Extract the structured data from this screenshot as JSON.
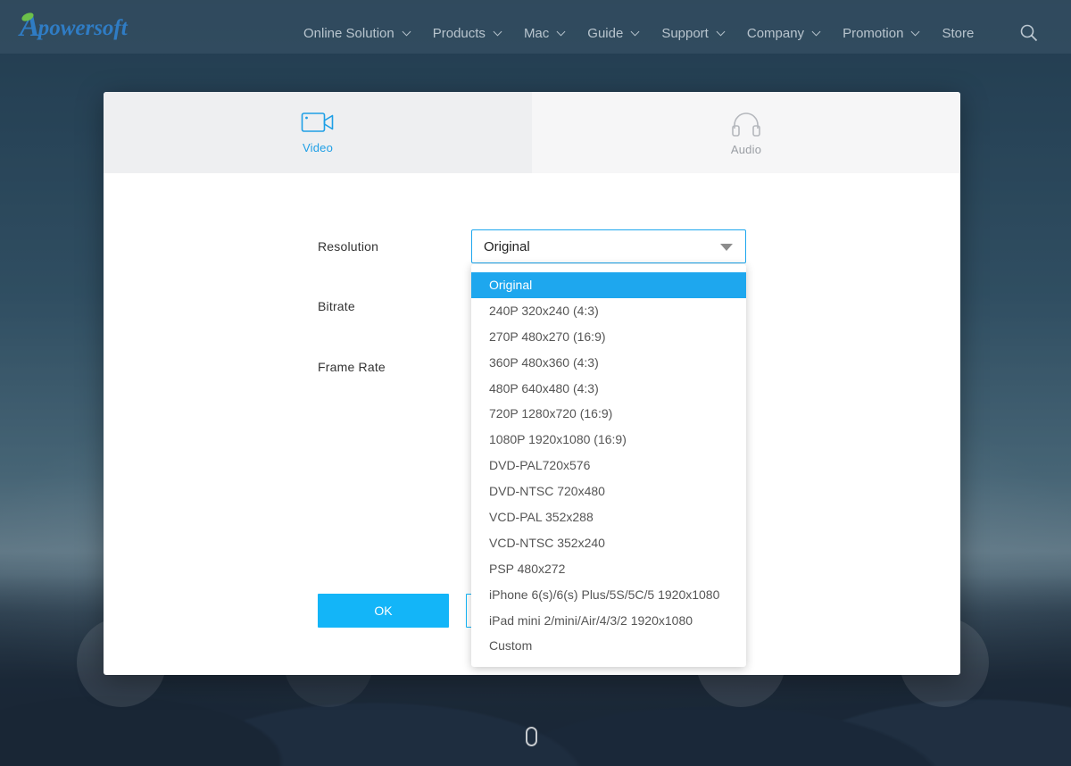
{
  "brand": {
    "logo_letter": "A",
    "logo_text": "powersoft"
  },
  "nav": {
    "items": [
      {
        "label": "Online Solution",
        "has_menu": true
      },
      {
        "label": "Products",
        "has_menu": true
      },
      {
        "label": "Mac",
        "has_menu": true
      },
      {
        "label": "Guide",
        "has_menu": true
      },
      {
        "label": "Support",
        "has_menu": true
      },
      {
        "label": "Company",
        "has_menu": true
      },
      {
        "label": "Promotion",
        "has_menu": true
      },
      {
        "label": "Store",
        "has_menu": false
      }
    ],
    "search_icon": "search-icon"
  },
  "modal": {
    "tabs": [
      {
        "label": "Video",
        "icon": "video-camera-icon",
        "active": true
      },
      {
        "label": "Audio",
        "icon": "headphones-icon",
        "active": false
      }
    ],
    "fields": {
      "resolution_label": "Resolution",
      "bitrate_label": "Bitrate",
      "frame_rate_label": "Frame Rate"
    },
    "resolution_select": {
      "value": "Original",
      "options": [
        "Original",
        "240P 320x240 (4:3)",
        "270P 480x270 (16:9)",
        "360P 480x360 (4:3)",
        "480P 640x480 (4:3)",
        "720P 1280x720 (16:9)",
        "1080P 1920x1080 (16:9)",
        "DVD-PAL720x576",
        "DVD-NTSC 720x480",
        "VCD-PAL 352x288",
        "VCD-NTSC 352x240",
        "PSP 480x272",
        "iPhone 6(s)/6(s) Plus/5S/5C/5 1920x1080",
        "iPad mini 2/mini/Air/4/3/2 1920x1080",
        "Custom"
      ],
      "selected_index": 0
    },
    "ok_label": "OK"
  },
  "colors": {
    "accent": "#1ea7ee",
    "ok_button": "#13b5f8",
    "inactive_tab_text": "#9a9ea4"
  }
}
